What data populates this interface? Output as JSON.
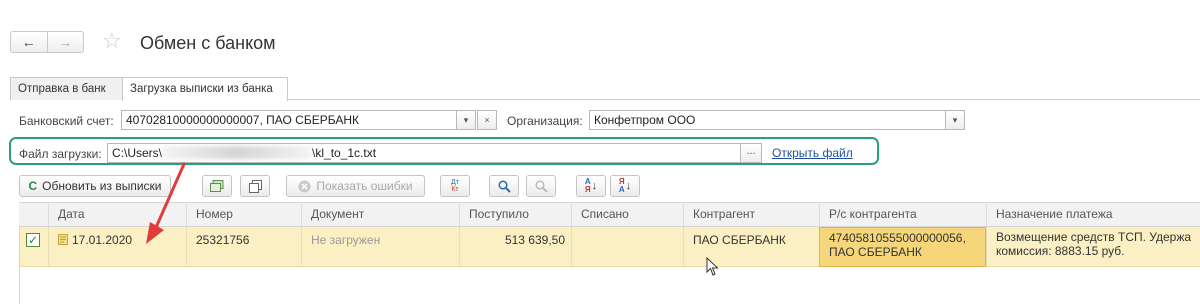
{
  "header": {
    "back_icon": "←",
    "forward_icon": "→",
    "star_icon": "☆",
    "title": "Обмен с банком"
  },
  "tabs": [
    {
      "label": "Отправка в банк",
      "active": false
    },
    {
      "label": "Загрузка выписки из банка",
      "active": true
    }
  ],
  "form": {
    "account_label": "Банковский счет:",
    "account_value": "40702810000000000007, ПАО СБЕРБАНК",
    "org_label": "Организация:",
    "org_value": "Конфетпром ООО",
    "file_label": "Файл загрузки:",
    "file_value_prefix": "C:\\Users\\",
    "file_value_suffix": "\\kl_to_1c.txt",
    "file_ellipsis": "...",
    "open_file_link": "Открыть файл",
    "dropdown_icon": "▾",
    "clear_icon": "×"
  },
  "toolbar": {
    "refresh_icon": "C",
    "refresh_label": "Обновить из выписки",
    "show_errors_label": "Показать ошибки",
    "dtkt_label_top": "Дт",
    "dtkt_label_bottom": "Кт",
    "sort_asc_top": "А",
    "sort_asc_bottom": "Я",
    "sort_desc_top": "Я",
    "sort_desc_bottom": "А"
  },
  "table": {
    "columns": [
      "Дата",
      "Номер",
      "Документ",
      "Поступило",
      "Списано",
      "Контрагент",
      "Р/с контрагента",
      "Назначение платежа"
    ],
    "rows": [
      {
        "checked": true,
        "date": "17.01.2020",
        "number": "25321756",
        "document": "Не загружен",
        "received": "513 639,50",
        "spent": "",
        "counterparty": "ПАО СБЕРБАНК",
        "account_line1": "47405810555000000056,",
        "account_line2": "ПАО СБЕРБАНК",
        "purpose_line1": "Возмещение средств ТСП. Удержа",
        "purpose_line2": "комиссия: 8883.15 руб."
      }
    ]
  },
  "colors": {
    "highlight_border": "#27a17c",
    "annotation_arrow": "#e23b3b",
    "row_selected": "#fbf0c3",
    "cell_selected": "#f6d67a"
  }
}
